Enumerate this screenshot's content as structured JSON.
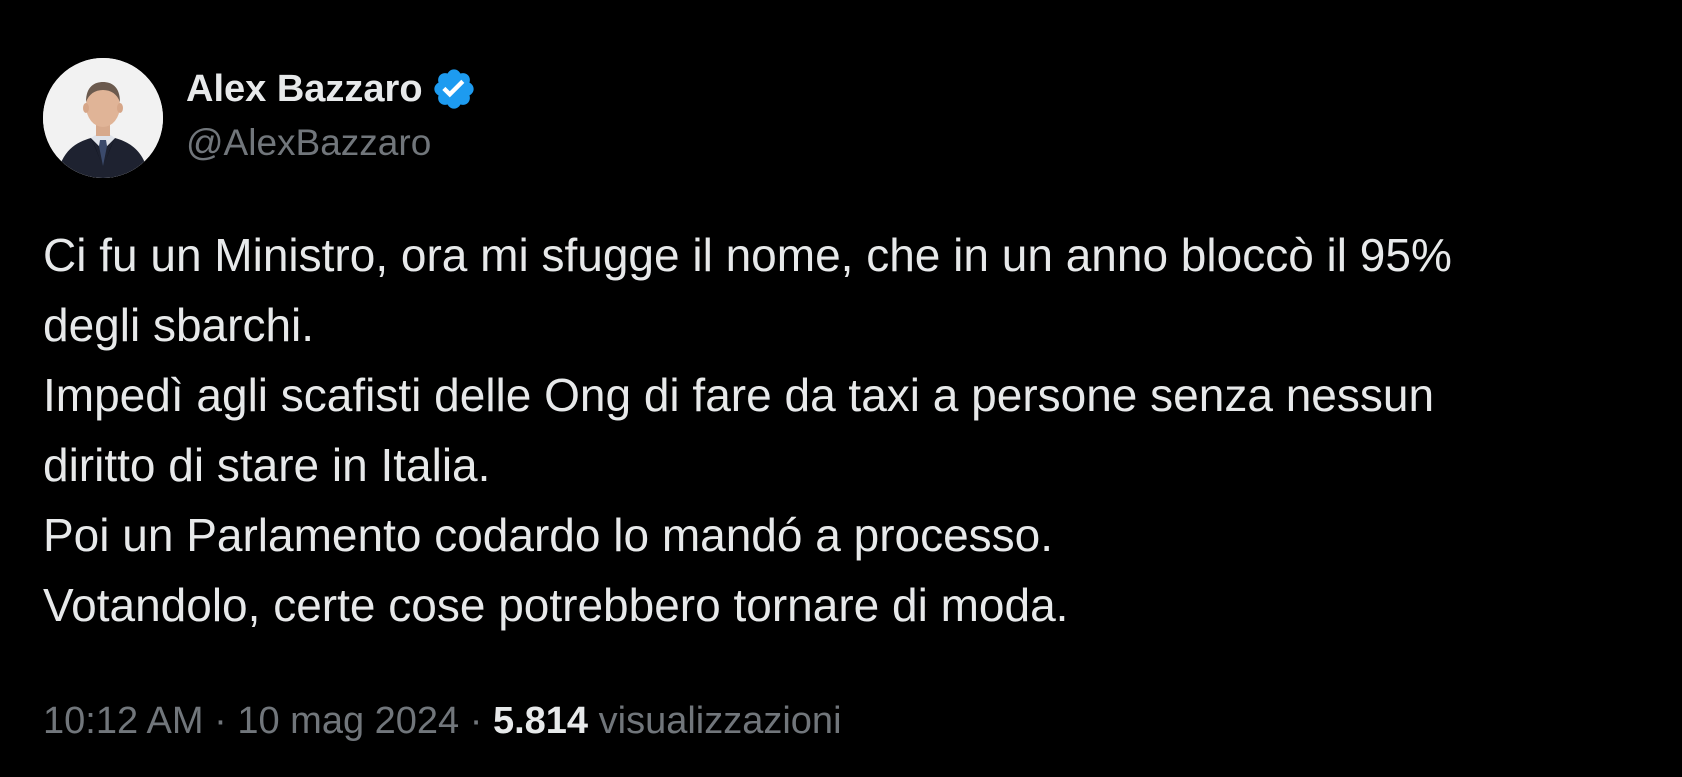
{
  "author": {
    "display_name": "Alex Bazzaro",
    "handle": "@AlexBazzaro",
    "verified": true,
    "verified_color": "#1d9bf0",
    "avatar_icon": "profile-photo"
  },
  "tweet": {
    "lines": [
      "Ci fu un Ministro, ora mi sfugge il nome, che in un anno bloccò il 95%",
      "degli sbarchi.",
      "Impedì agli scafisti delle Ong di fare da taxi a persone senza nessun",
      "diritto di stare in Italia.",
      "Poi un Parlamento codardo lo mandó a processo.",
      "Votandolo, certe cose potrebbero tornare di moda."
    ]
  },
  "meta": {
    "time": "10:12 AM",
    "separator": " · ",
    "date": "10 mag 2024",
    "views_count": "5.814",
    "views_label": "visualizzazioni"
  },
  "colors": {
    "background": "#000000",
    "text_primary": "#e7e9ea",
    "text_secondary": "#71767b",
    "accent": "#1d9bf0"
  }
}
